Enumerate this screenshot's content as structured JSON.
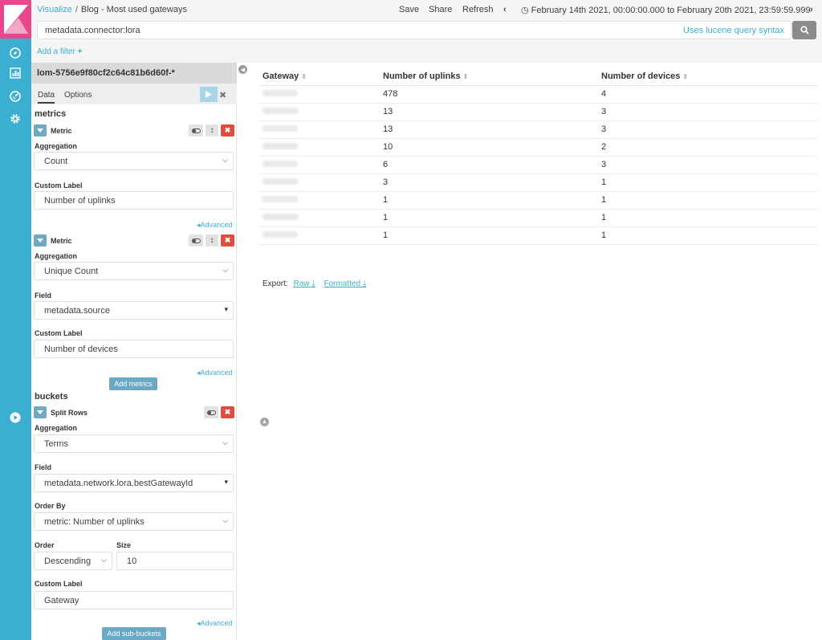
{
  "breadcrumb": {
    "app": "Visualize",
    "separator": "/",
    "title": "Blog - Most used gateways"
  },
  "topnav": {
    "save": "Save",
    "share": "Share",
    "refresh": "Refresh",
    "time_range": "February 14th 2021, 00:00:00.000 to February 20th 2021, 23:59:59.999"
  },
  "query": {
    "value": "metadata.connector:lora",
    "hint": "Uses lucene query syntax"
  },
  "filter": {
    "add_label": "Add a filter"
  },
  "sidebar": {
    "index_pattern": "lom-5756e9f80cf2c64c81b6d60f-*",
    "tabs": [
      "Data",
      "Options"
    ],
    "metrics_title": "metrics",
    "buckets_title": "buckets",
    "advanced": "Advanced",
    "add_metrics": "Add metrics",
    "add_sub_buckets": "Add sub-buckets",
    "metric1": {
      "title": "Metric",
      "agg_label": "Aggregation",
      "agg_value": "Count",
      "custom_label_label": "Custom Label",
      "custom_label_value": "Number of uplinks"
    },
    "metric2": {
      "title": "Metric",
      "agg_label": "Aggregation",
      "agg_value": "Unique Count",
      "field_label": "Field",
      "field_value": "metadata.source",
      "custom_label_label": "Custom Label",
      "custom_label_value": "Number of devices"
    },
    "bucket": {
      "title": "Split Rows",
      "agg_label": "Aggregation",
      "agg_value": "Terms",
      "field_label": "Field",
      "field_value": "metadata.network.lora.bestGatewayId",
      "order_by_label": "Order By",
      "order_by_value": "metric: Number of uplinks",
      "order_label": "Order",
      "order_value": "Descending",
      "size_label": "Size",
      "size_value": "10",
      "custom_label_label": "Custom Label",
      "custom_label_value": "Gateway"
    }
  },
  "table": {
    "headers": [
      "Gateway",
      "Number of uplinks",
      "Number of devices"
    ],
    "rows": [
      [
        "478",
        "4"
      ],
      [
        "13",
        "3"
      ],
      [
        "13",
        "3"
      ],
      [
        "10",
        "2"
      ],
      [
        "6",
        "3"
      ],
      [
        "3",
        "1"
      ],
      [
        "1",
        "1"
      ],
      [
        "1",
        "1"
      ],
      [
        "1",
        "1"
      ]
    ]
  },
  "export": {
    "label": "Export:",
    "raw": "Raw",
    "formatted": "Formatted"
  },
  "colors": {
    "nav": "#3caed2",
    "logo": "#e8488b",
    "accent": "#3caed2",
    "danger": "#e04d3f"
  }
}
